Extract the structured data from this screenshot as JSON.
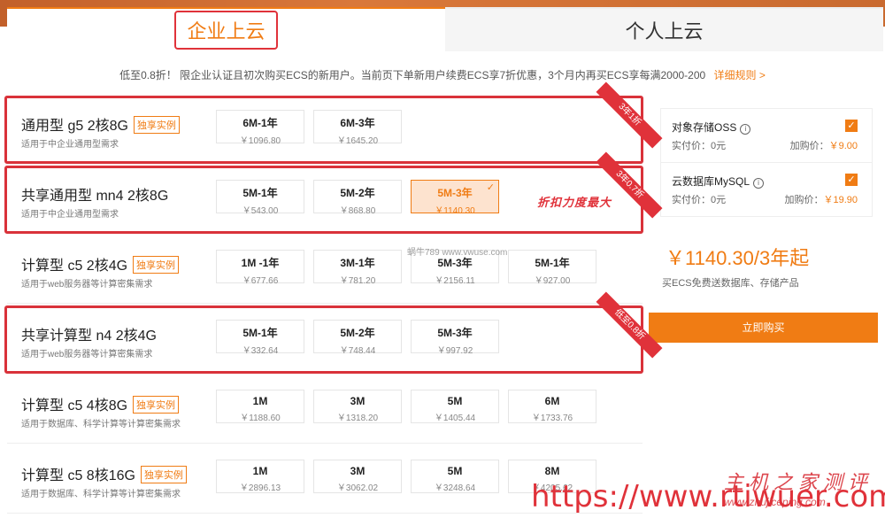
{
  "tabs": {
    "enterprise": "企业上云",
    "personal": "个人上云"
  },
  "promo": {
    "text": "低至0.8折！ 限企业认证且初次购买ECS的新用户。当前页下单新用户续费ECS享7折优惠，3个月内再买ECS享每满2000-200",
    "link": "详细规则 >"
  },
  "rows": [
    {
      "title": "通用型 g5 2核8G",
      "badge": "独享实例",
      "desc": "适用于中企业通用型需求",
      "ribbon": "3年1折",
      "options": [
        {
          "label": "6M-1年",
          "price": "￥1096.80"
        },
        {
          "label": "6M-3年",
          "price": "￥1645.20"
        }
      ]
    },
    {
      "title": "共享通用型 mn4 2核8G",
      "badge": "",
      "desc": "适用于中企业通用型需求",
      "ribbon": "3年0.7折",
      "options": [
        {
          "label": "5M-1年",
          "price": "￥543.00"
        },
        {
          "label": "5M-2年",
          "price": "￥868.80"
        },
        {
          "label": "5M-3年",
          "price": "￥1140.30"
        }
      ]
    },
    {
      "title": "计算型 c5 2核4G",
      "badge": "独享实例",
      "desc": "适用于web服务器等计算密集需求",
      "ribbon": "",
      "options": [
        {
          "label": "1M -1年",
          "price": "￥677.66"
        },
        {
          "label": "3M-1年",
          "price": "￥781.20"
        },
        {
          "label": "5M-3年",
          "price": "￥2156.11"
        },
        {
          "label": "5M-1年",
          "price": "￥927.00"
        }
      ]
    },
    {
      "title": "共享计算型 n4 2核4G",
      "badge": "",
      "desc": "适用于web服务器等计算密集需求",
      "ribbon": "低至0.8折",
      "options": [
        {
          "label": "5M-1年",
          "price": "￥332.64"
        },
        {
          "label": "5M-2年",
          "price": "￥748.44"
        },
        {
          "label": "5M-3年",
          "price": "￥997.92"
        }
      ]
    },
    {
      "title": "计算型 c5 4核8G",
      "badge": "独享实例",
      "desc": "适用于数据库、科学计算等计算密集需求",
      "ribbon": "",
      "options": [
        {
          "label": "1M",
          "price": "￥1188.60"
        },
        {
          "label": "3M",
          "price": "￥1318.20"
        },
        {
          "label": "5M",
          "price": "￥1405.44"
        },
        {
          "label": "6M",
          "price": "￥1733.76"
        }
      ]
    },
    {
      "title": "计算型 c5 8核16G",
      "badge": "独享实例",
      "desc": "适用于数据库、科学计算等计算密集需求",
      "ribbon": "",
      "options": [
        {
          "label": "1M",
          "price": "￥2896.13"
        },
        {
          "label": "3M",
          "price": "￥3062.02"
        },
        {
          "label": "5M",
          "price": "￥3248.64"
        },
        {
          "label": "8M",
          "price": "￥4205.62"
        }
      ]
    }
  ],
  "annotation": "折扣力度最大",
  "side": {
    "addons": [
      {
        "name": "对象存储OSS",
        "info_icon": "i",
        "paid": "实付价：0元",
        "buy_label": "加购价：",
        "buy_value": "￥9.00"
      },
      {
        "name": "云数据库MySQL",
        "info_icon": "i",
        "paid": "实付价：0元",
        "buy_label": "加购价：",
        "buy_value": "￥19.90"
      }
    ],
    "price": "￥1140.30/3年起",
    "price_sub": "买ECS免费送数据库、存储产品",
    "buy_button": "立即购买"
  },
  "watermark": {
    "brand": "主机之家测评",
    "url": "https://www.rtiwuer.com",
    "domain": "www.zhujiceping.com",
    "center": "蜗牛789 www.vwuse.com"
  },
  "colors": {
    "accent": "#f07c14",
    "highlight_border": "#d9323a"
  }
}
